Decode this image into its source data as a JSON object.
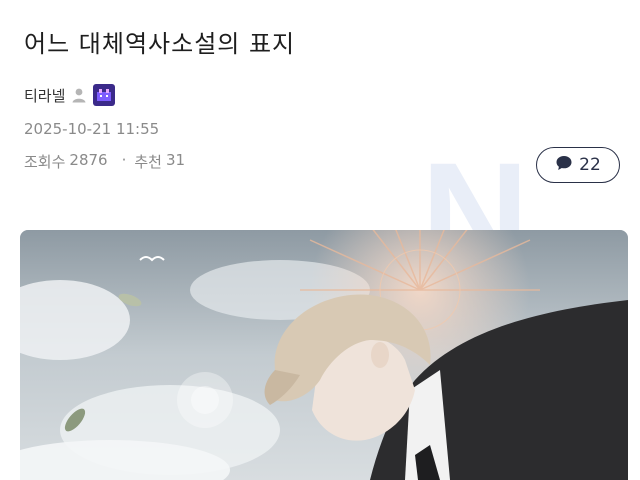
{
  "post": {
    "title": "어느 대체역사소설의 표지",
    "author": "티라넬",
    "date": "2025-10-21 11:55",
    "views_label": "조회수",
    "views": "2876",
    "recommend_label": "추천",
    "recommend": "31",
    "separator": "·"
  },
  "comments": {
    "count": "22"
  },
  "watermark": {
    "text": "N"
  },
  "icons": {
    "user": "user-icon",
    "badge": "level-badge-icon",
    "comment": "speech-bubble-icon"
  },
  "colors": {
    "comment_border": "#2a3148",
    "badge": "#3b2a8a",
    "meta_text": "#8a8a8a"
  }
}
